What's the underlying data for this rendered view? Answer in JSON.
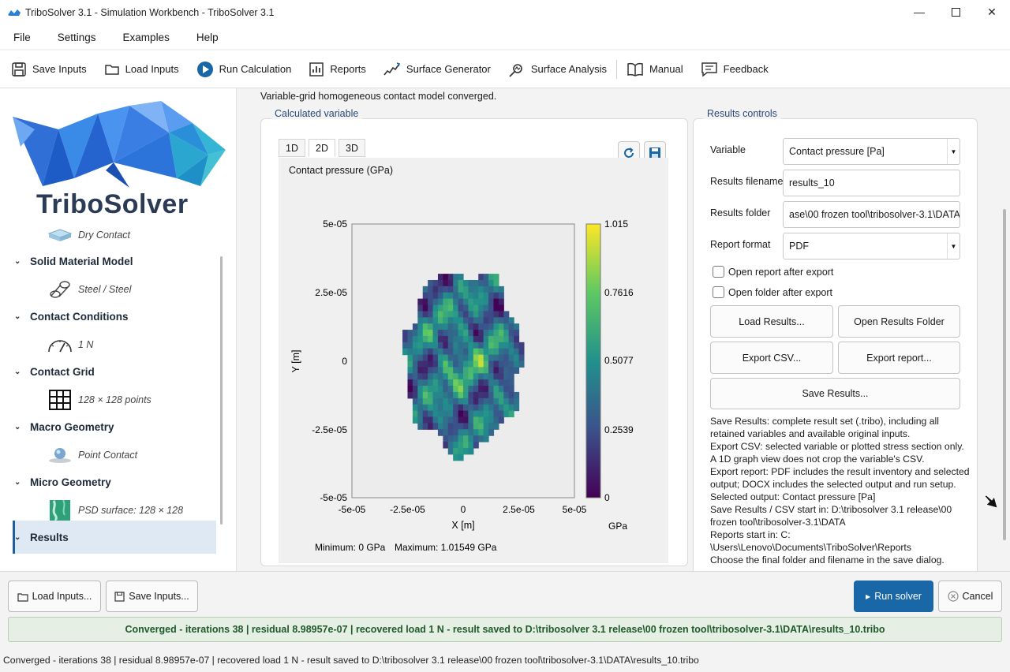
{
  "window": {
    "title": "TriboSolver 3.1 - Simulation Workbench - TriboSolver 3.1"
  },
  "menu": [
    "File",
    "Settings",
    "Examples",
    "Help"
  ],
  "toolbar": {
    "save_inputs": "Save Inputs",
    "load_inputs": "Load Inputs",
    "run_calculation": "Run Calculation",
    "reports": "Reports",
    "surface_generator": "Surface Generator",
    "surface_analysis": "Surface Analysis",
    "manual": "Manual",
    "feedback": "Feedback"
  },
  "sidebar": {
    "brand": "TriboSolver",
    "lubrication_value": "Dry Contact",
    "items": [
      {
        "label": "Solid Material Model",
        "value": "Steel / Steel"
      },
      {
        "label": "Contact Conditions",
        "value": "1 N"
      },
      {
        "label": "Contact Grid",
        "value": "128 × 128 points"
      },
      {
        "label": "Macro Geometry",
        "value": "Point Contact"
      },
      {
        "label": "Micro Geometry",
        "value": "PSD surface: 128 × 128"
      },
      {
        "label": "Results",
        "value": ""
      }
    ]
  },
  "main": {
    "converged_note": "Variable-grid homogeneous contact model converged.",
    "calc_group_label": "Calculated variable",
    "tabs": [
      "1D",
      "2D",
      "3D"
    ],
    "plot": {
      "title": "Contact pressure (GPa)",
      "xlabel": "X [m]",
      "ylabel": "Y [m]",
      "x_ticks": [
        "-5e-05",
        "-2.5e-05",
        "0",
        "2.5e-05",
        "5e-05"
      ],
      "y_ticks": [
        "5e-05",
        "2.5e-05",
        "0",
        "-2.5e-05",
        "-5e-05"
      ],
      "colorbar_ticks": [
        "1.015",
        "0.7616",
        "0.5077",
        "0.2539",
        "0"
      ],
      "colorbar_unit": "GPa",
      "min_label": "Minimum: 0 GPa",
      "max_label": "Maximum: 1.01549 GPa"
    }
  },
  "chart_data": {
    "type": "heatmap",
    "title": "Contact pressure (GPa)",
    "xlabel": "X [m]",
    "ylabel": "Y [m]",
    "xlim": [
      -5e-05,
      5e-05
    ],
    "ylim": [
      -5e-05,
      5e-05
    ],
    "colorbar_range": [
      0,
      1.015
    ],
    "colorbar_ticks": [
      1.015,
      0.7616,
      0.5077,
      0.2539,
      0
    ],
    "colorbar_label": "GPa",
    "min": 0,
    "max": 1.01549,
    "colormap": "viridis",
    "contact_region": {
      "center": [
        0,
        0
      ],
      "radius_x": 2.6e-05,
      "radius_y": 3.3e-05
    }
  },
  "controls": {
    "group_label": "Results controls",
    "variable_label": "Variable",
    "variable_value": "Contact pressure [Pa]",
    "filename_label": "Results filename",
    "filename_value": "results_10",
    "folder_label": "Results folder",
    "folder_value": "ase\\00 frozen tool\\tribosolver-3.1\\DATA",
    "format_label": "Report format",
    "format_value": "PDF",
    "open_report": "Open report after export",
    "open_folder": "Open folder after export",
    "load_results": "Load Results...",
    "open_results_folder": "Open Results Folder",
    "export_csv": "Export CSV...",
    "export_report": "Export report...",
    "save_results": "Save Results...",
    "info": [
      "Save Results: complete result set (.tribo), including all",
      "retained variables and available original inputs.",
      "Export CSV: selected variable or plotted stress section only.",
      "A 1D graph view does not crop the variable's CSV.",
      "Export report: PDF includes the result inventory and selected",
      "output; DOCX includes the selected output and run setup.",
      "Selected output: Contact pressure [Pa]",
      "Save Results / CSV start in: D:\\tribosolver 3.1 release\\00",
      "frozen tool\\tribosolver-3.1\\DATA",
      "Reports start in: C:",
      "\\Users\\Lenovo\\Documents\\TriboSolver\\Reports",
      "Choose the final folder and filename in the save dialog."
    ]
  },
  "bottom": {
    "load_inputs": "Load Inputs...",
    "save_inputs": "Save Inputs...",
    "run_solver": "Run solver",
    "cancel": "Cancel",
    "banner": "Converged - iterations 38 | residual 8.98957e-07 | recovered load 1 N - result saved to D:\\tribosolver 3.1 release\\00 frozen tool\\tribosolver-3.1\\DATA\\results_10.tribo",
    "status": "Converged - iterations 38 | residual 8.98957e-07 | recovered load 1 N - result saved to D:\\tribosolver 3.1 release\\00 frozen tool\\tribosolver-3.1\\DATA\\results_10.tribo"
  },
  "colors": {
    "accent": "#1a67a8",
    "banner_bg": "#e5efe3",
    "banner_text": "#1f5a2a",
    "brand_text": "#2b3a55"
  }
}
